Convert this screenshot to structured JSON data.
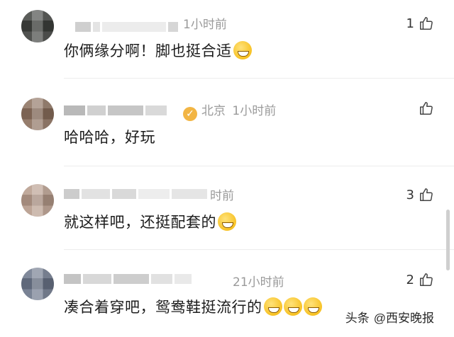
{
  "comments": [
    {
      "time": "1小时前",
      "likes": "1",
      "text": "你俩缘分啊！脚也挺合适",
      "emoji": "laughing-tears-emoji"
    },
    {
      "verified": true,
      "location": "北京",
      "time": "1小时前",
      "likes": "",
      "text": "哈哈哈，好玩"
    },
    {
      "time": "时前",
      "likes": "3",
      "text": "就这样吧，还挺配套的",
      "emoji": "laughing-tears-emoji"
    },
    {
      "time": "21小时前",
      "likes": "2",
      "text": "凑合着穿吧，鸳鸯鞋挺流行的",
      "emoji": "grinning-emoji"
    }
  ],
  "watermark": {
    "prefix": "头条",
    "handle": "@西安晚报"
  },
  "colors": {
    "meta_text": "#9a9a9a",
    "body_text": "#1c1c1c",
    "verified_badge": "#f2b544"
  }
}
